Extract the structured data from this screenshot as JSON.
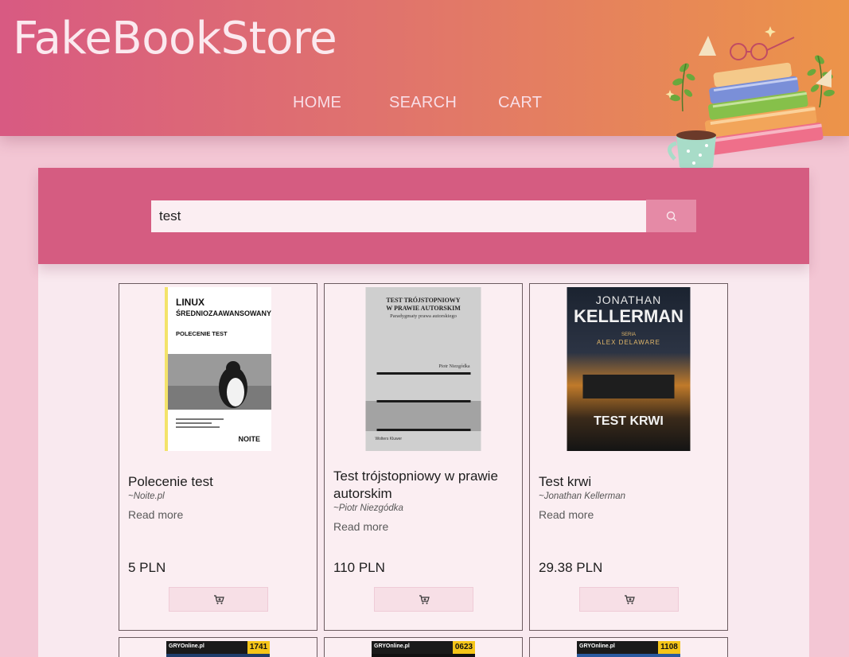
{
  "header": {
    "logo": "FakeBookStore",
    "nav": [
      "HOME",
      "SEARCH",
      "CART"
    ]
  },
  "search": {
    "value": "test",
    "icon": "search-icon"
  },
  "books": [
    {
      "title": "Polecenie test",
      "author": "~Noite.pl",
      "read_more": "Read more",
      "price": "5 PLN",
      "cover": {
        "line1": "LINUX",
        "line2": "ŚREDNIOZAAWANSOWANY",
        "line3": "POLECENIE TEST",
        "brand": "NOITE"
      }
    },
    {
      "title": "Test trójstopniowy w prawie autorskim",
      "author": "~Piotr Niezgódka",
      "read_more": "Read more",
      "price": "110 PLN",
      "cover": {
        "line1": "TEST TRÓJSTOPNIOWY",
        "line2": "W PRAWIE AUTORSKIM",
        "line3": "Paradygmaty prawa autorskiego",
        "author": "Piotr Niezgódka",
        "brand": "Wolters Kluwer"
      }
    },
    {
      "title": "Test krwi",
      "author": "~Jonathan Kellerman",
      "read_more": "Read more",
      "price": "29.38 PLN",
      "cover": {
        "line1": "JONATHAN",
        "line2": "KELLERMAN",
        "line3": "SERIA",
        "line4": "ALEX DELAWARE",
        "line5": "TEST KRWI"
      }
    }
  ],
  "next_row": [
    {
      "label": "GRYOnline.pl",
      "num": "1741"
    },
    {
      "label": "GRYOnline.pl",
      "num": "0623"
    },
    {
      "label": "GRYOnline.pl",
      "num": "1108"
    }
  ],
  "colors": {
    "header_start": "#d85a82",
    "header_end": "#ec9449",
    "band": "#d55c81",
    "background": "#f3c6d4"
  }
}
